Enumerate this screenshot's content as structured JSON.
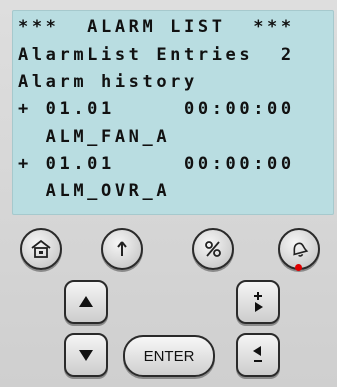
{
  "screen": {
    "lines": [
      "***  ALARM LIST  ***",
      "AlarmList Entries  2",
      "Alarm history",
      "+ 01.01     00:00:00",
      "  ALM_FAN_A",
      "+ 01.01     00:00:00",
      "  ALM_OVR_A"
    ]
  },
  "keypad": {
    "enter_label": "ENTER",
    "icons": {
      "home": "home-icon",
      "info": "info-icon",
      "percent": "percent-icon",
      "alarm": "bell-icon",
      "up": "arrow-up-icon",
      "down": "arrow-down-icon",
      "plus_right": "increment-icon",
      "minus_left": "decrement-icon"
    },
    "alarm_indicator_color": "#e00000"
  }
}
